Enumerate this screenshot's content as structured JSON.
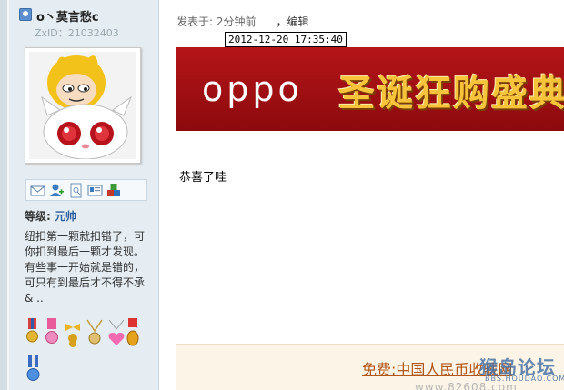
{
  "user": {
    "name": "o丶莫言愁c",
    "zxid": "ZxID：21032403",
    "level_label": "等级:",
    "level_value": "元帅",
    "signature": "纽扣第一颗就扣错了，可你扣到最后一颗才发现。 有些事一开始就是错的，可只有到最后才不得不承& ..",
    "action_icons": [
      "mail-icon",
      "add-friend-icon",
      "profile-icon",
      "card-icon",
      "blocks-icon"
    ],
    "medals": [
      "medal-ribbon-1",
      "medal-ribbon-2",
      "medal-bow",
      "medal-necklace",
      "medal-heart",
      "medal-trophy",
      "medal-ribbon-3",
      "medal-ribbon-4",
      "medal-ribbon-5",
      "medal-ribbon-6",
      "medal-ribbon-7"
    ]
  },
  "post": {
    "posted_label": "发表于: 2分钟前",
    "edit_label": "，编辑",
    "tooltip": "2012-12-20 17:35:40",
    "body": "恭喜了哇"
  },
  "banner": {
    "brand": "oppo",
    "promo": "圣诞狂购盛典",
    "colors": {
      "background": "#9e0f12",
      "promo_text": "#f6c33a"
    }
  },
  "footer_ad": {
    "link_text": "免费:中国人民币收藏网",
    "url_text": "www.82608.com"
  },
  "watermark": {
    "main": "猴岛论坛",
    "sub": "BBS.HOUDAO.COM"
  }
}
